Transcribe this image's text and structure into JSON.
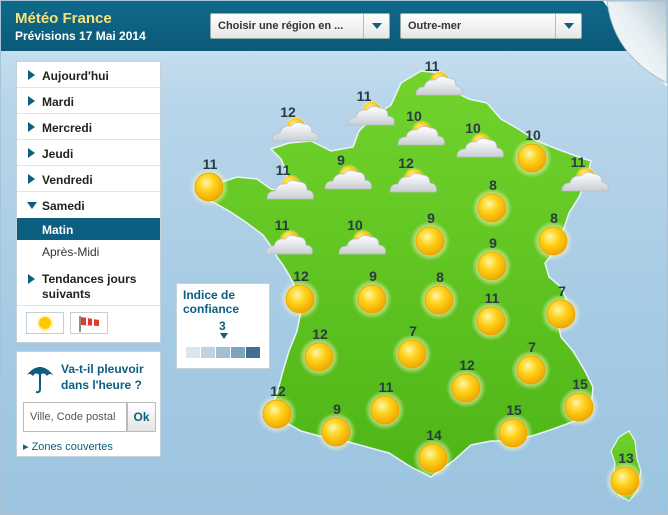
{
  "header": {
    "title": "Météo France",
    "subtitle": "Prévisions 17 Mai 2014",
    "region_select": "Choisir une région en ...",
    "outremer_select": "Outre-mer"
  },
  "days": [
    {
      "label": "Aujourd'hui"
    },
    {
      "label": "Mardi"
    },
    {
      "label": "Mercredi"
    },
    {
      "label": "Jeudi"
    },
    {
      "label": "Vendredi"
    },
    {
      "label": "Samedi"
    }
  ],
  "subitems": [
    {
      "label": "Matin"
    },
    {
      "label": "Après-Midi"
    }
  ],
  "tendances": "Tendances jours suivants",
  "rain": {
    "question": "Va-t-il pleuvoir dans l'heure ?",
    "placeholder": "Ville, Code postal",
    "ok": "Ok",
    "zones": "▸ Zones couvertes"
  },
  "confidence": {
    "title": "Indice de confiance",
    "value": "3"
  },
  "forecast": [
    {
      "icon": "sun-cloud",
      "temp": "11"
    },
    {
      "icon": "sun-cloud",
      "temp": "11"
    },
    {
      "icon": "sun-cloud",
      "temp": "12"
    },
    {
      "icon": "sun-cloud",
      "temp": "10"
    },
    {
      "icon": "sun-cloud",
      "temp": "10"
    },
    {
      "icon": "sun",
      "temp": "10"
    },
    {
      "icon": "sun-cloud",
      "temp": "9"
    },
    {
      "icon": "sun-cloud",
      "temp": "12"
    },
    {
      "icon": "sun",
      "temp": "11"
    },
    {
      "icon": "sun-cloud",
      "temp": "11"
    },
    {
      "icon": "sun-cloud",
      "temp": "11"
    },
    {
      "icon": "sun",
      "temp": "8"
    },
    {
      "icon": "sun",
      "temp": "8"
    },
    {
      "icon": "sun-cloud",
      "temp": "11"
    },
    {
      "icon": "sun-cloud",
      "temp": "10"
    },
    {
      "icon": "sun",
      "temp": "9"
    },
    {
      "icon": "sun",
      "temp": "9"
    },
    {
      "icon": "sun",
      "temp": "12"
    },
    {
      "icon": "sun",
      "temp": "9"
    },
    {
      "icon": "sun",
      "temp": "8"
    },
    {
      "icon": "sun",
      "temp": "7"
    },
    {
      "icon": "sun",
      "temp": "11"
    },
    {
      "icon": "sun",
      "temp": "12"
    },
    {
      "icon": "sun",
      "temp": "7"
    },
    {
      "icon": "sun",
      "temp": "7"
    },
    {
      "icon": "sun",
      "temp": "12"
    },
    {
      "icon": "sun",
      "temp": "15"
    },
    {
      "icon": "sun",
      "temp": "12"
    },
    {
      "icon": "sun",
      "temp": "9"
    },
    {
      "icon": "sun",
      "temp": "11"
    },
    {
      "icon": "sun",
      "temp": "15"
    },
    {
      "icon": "sun",
      "temp": "14"
    },
    {
      "icon": "sun",
      "temp": "13"
    }
  ],
  "colors": {
    "header": "#0c5f80",
    "title": "#f7e27a",
    "land": "#5cc51e",
    "sea": "#a6cbe4",
    "sun": "#f6c400"
  }
}
